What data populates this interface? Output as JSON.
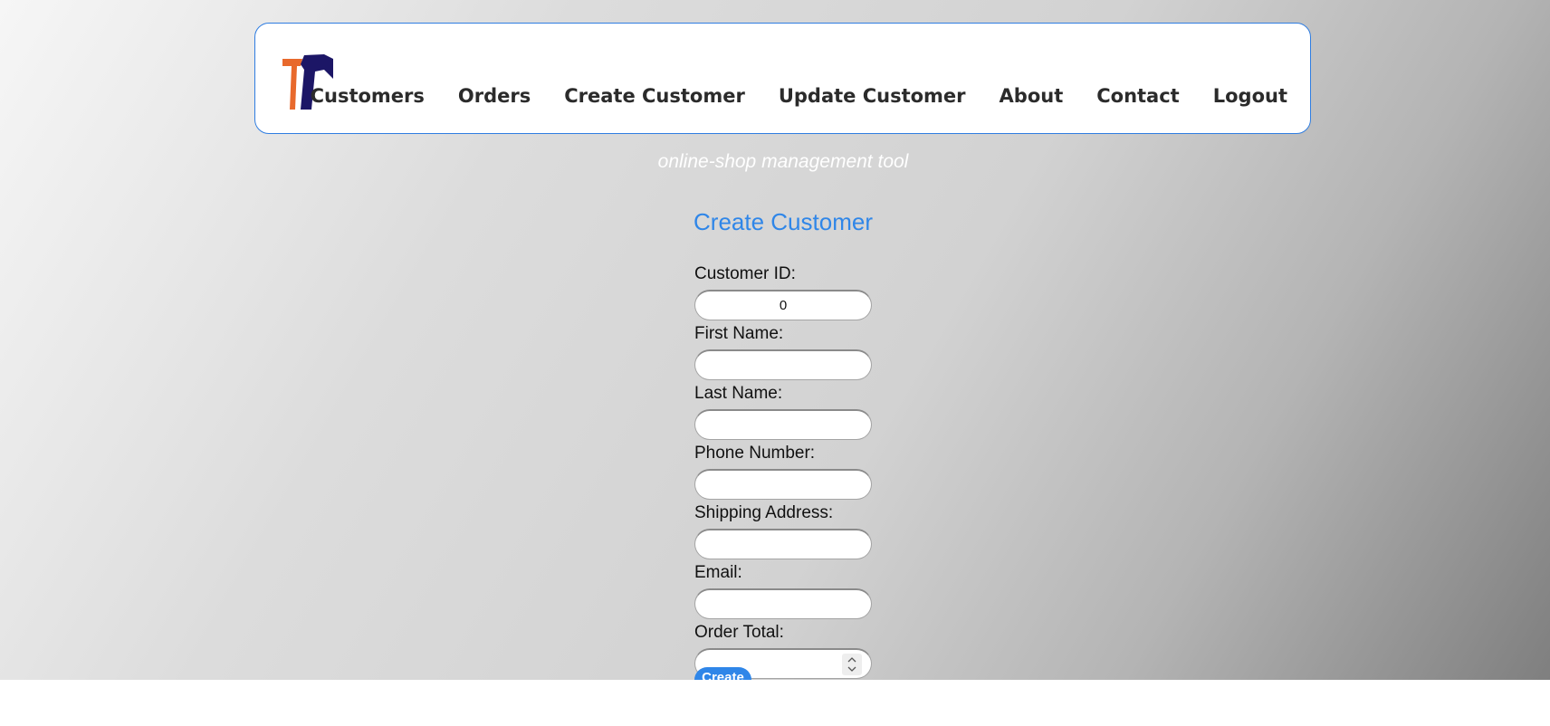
{
  "nav": {
    "items": [
      "Customers",
      "Orders",
      "Create Customer",
      "Update Customer",
      "About",
      "Contact",
      "Logout"
    ]
  },
  "tagline": "online-shop management tool",
  "page_title": "Create Customer",
  "form": {
    "customer_id": {
      "label": "Customer ID:",
      "value": "0"
    },
    "first_name": {
      "label": "First Name:",
      "value": ""
    },
    "last_name": {
      "label": "Last Name:",
      "value": ""
    },
    "phone_number": {
      "label": "Phone Number:",
      "value": ""
    },
    "shipping_address": {
      "label": "Shipping Address:",
      "value": ""
    },
    "email": {
      "label": "Email:",
      "value": ""
    },
    "order_total": {
      "label": "Order Total:",
      "value": ""
    },
    "submit_label": "Create"
  },
  "colors": {
    "accent": "#2f86e8",
    "logo_orange": "#e8692c",
    "logo_navy": "#1c1666"
  }
}
